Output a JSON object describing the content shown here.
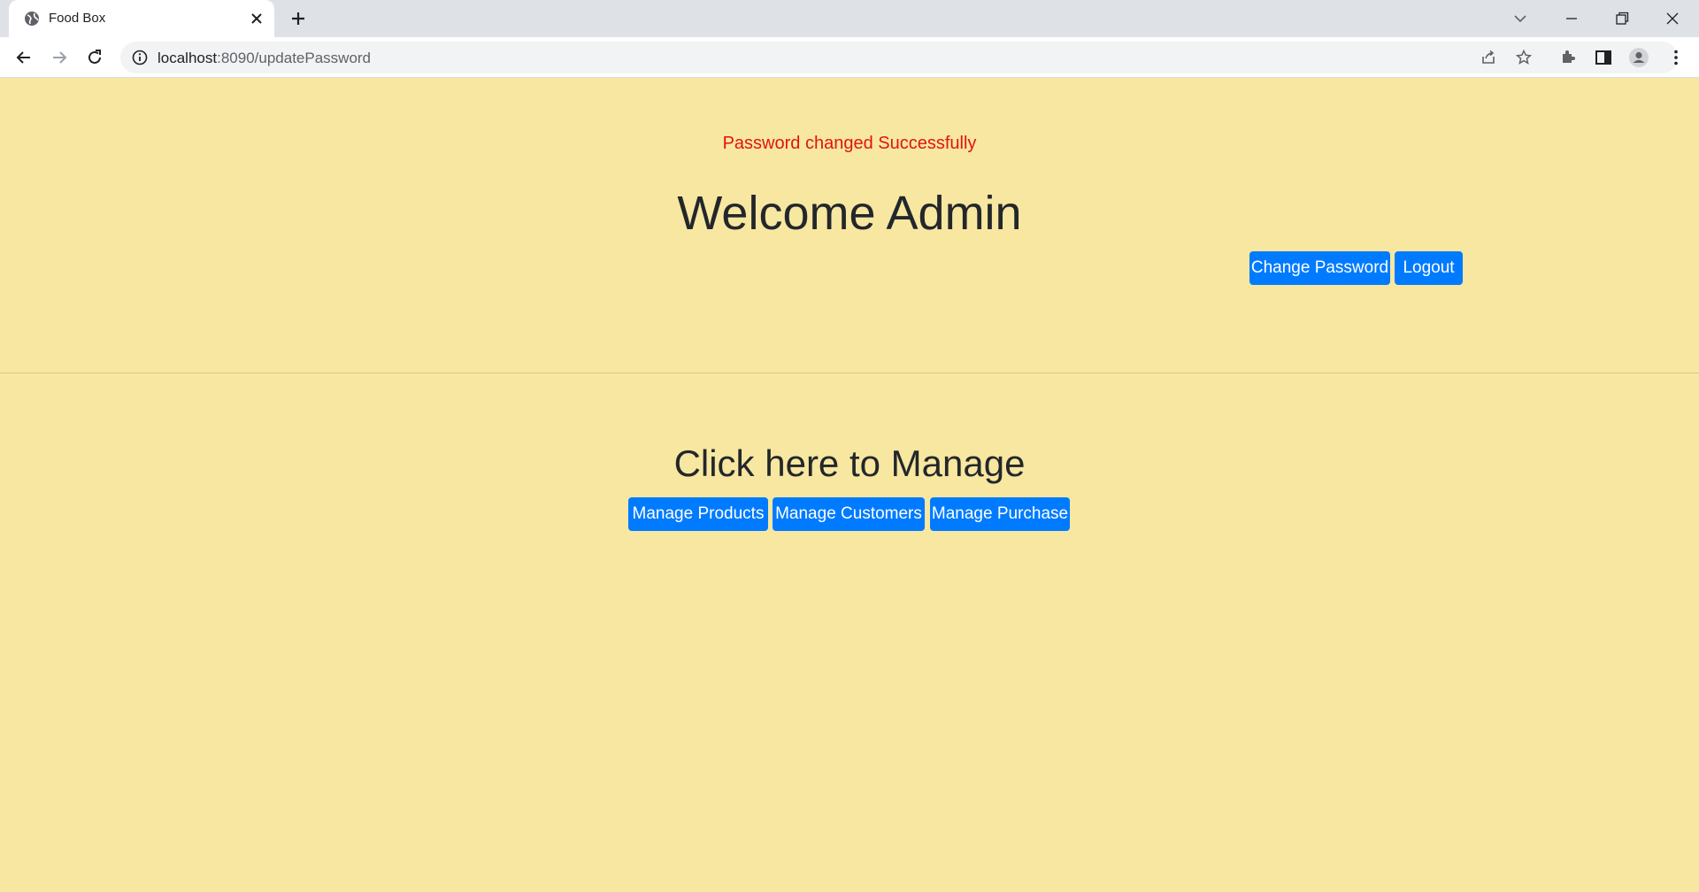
{
  "browser": {
    "tab_title": "Food Box",
    "url_host": "localhost",
    "url_path": ":8090/updatePassword"
  },
  "page": {
    "status_message": "Password changed Successfully",
    "welcome_heading": "Welcome Admin",
    "change_password_label": "Change Password",
    "logout_label": "Logout",
    "manage_heading": "Click here to Manage",
    "manage_products_label": "Manage Products",
    "manage_customers_label": "Manage Customers",
    "manage_purchase_label": "Manage Purchase"
  },
  "colors": {
    "page_background": "#f7e7a0",
    "button_primary": "#007bff",
    "message_text": "#e1140f"
  }
}
